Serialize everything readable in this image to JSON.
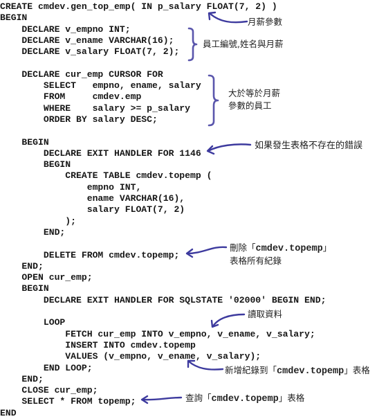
{
  "code_lines": [
    "CREATE cmdev.gen_top_emp( IN p_salary FLOAT(7, 2) )",
    "BEGIN",
    "    DECLARE v_empno INT;",
    "    DECLARE v_ename VARCHAR(16);",
    "    DECLARE v_salary FLOAT(7, 2);",
    "",
    "    DECLARE cur_emp CURSOR FOR",
    "        SELECT   empno, ename, salary",
    "        FROM     cmdev.emp",
    "        WHERE    salary >= p_salary",
    "        ORDER BY salary DESC;",
    "",
    "    BEGIN",
    "        DECLARE EXIT HANDLER FOR 1146",
    "        BEGIN",
    "            CREATE TABLE cmdev.topemp (",
    "                empno INT,",
    "                ename VARCHAR(16),",
    "                salary FLOAT(7, 2)",
    "            );",
    "        END;",
    "",
    "        DELETE FROM cmdev.topemp;",
    "    END;",
    "    OPEN cur_emp;",
    "    BEGIN",
    "        DECLARE EXIT HANDLER FOR SQLSTATE '02000' BEGIN END;",
    "",
    "        LOOP",
    "            FETCH cur_emp INTO v_empno, v_ename, v_salary;",
    "            INSERT INTO cmdev.topemp",
    "            VALUES (v_empno, v_ename, v_salary);",
    "        END LOOP;",
    "    END;",
    "    CLOSE cur_emp;",
    "    SELECT * FROM topemp;",
    "END"
  ],
  "annotations": {
    "salary_param": "月薪參數",
    "declare_vars": "員工編號,姓名與月薪",
    "cursor_line1": "大於等於月薪",
    "cursor_line2": "參數的員工",
    "table_missing": "如果發生表格不存在的錯誤",
    "delete_prefix": "刪除「",
    "delete_table": "cmdev.topemp",
    "delete_suffix": "」",
    "delete_line2": "表格所有紀錄",
    "fetch": "讀取資料",
    "insert_prefix": "新增紀錄到「",
    "insert_table": "cmdev.topemp",
    "insert_suffix": "」表格",
    "select_prefix": "查詢「",
    "select_table": "cmdev.topemp",
    "select_suffix": "」表格"
  },
  "colors": {
    "arrow": "#3d3a9e",
    "brace": "#5a56ac",
    "code_text": "#161616"
  }
}
